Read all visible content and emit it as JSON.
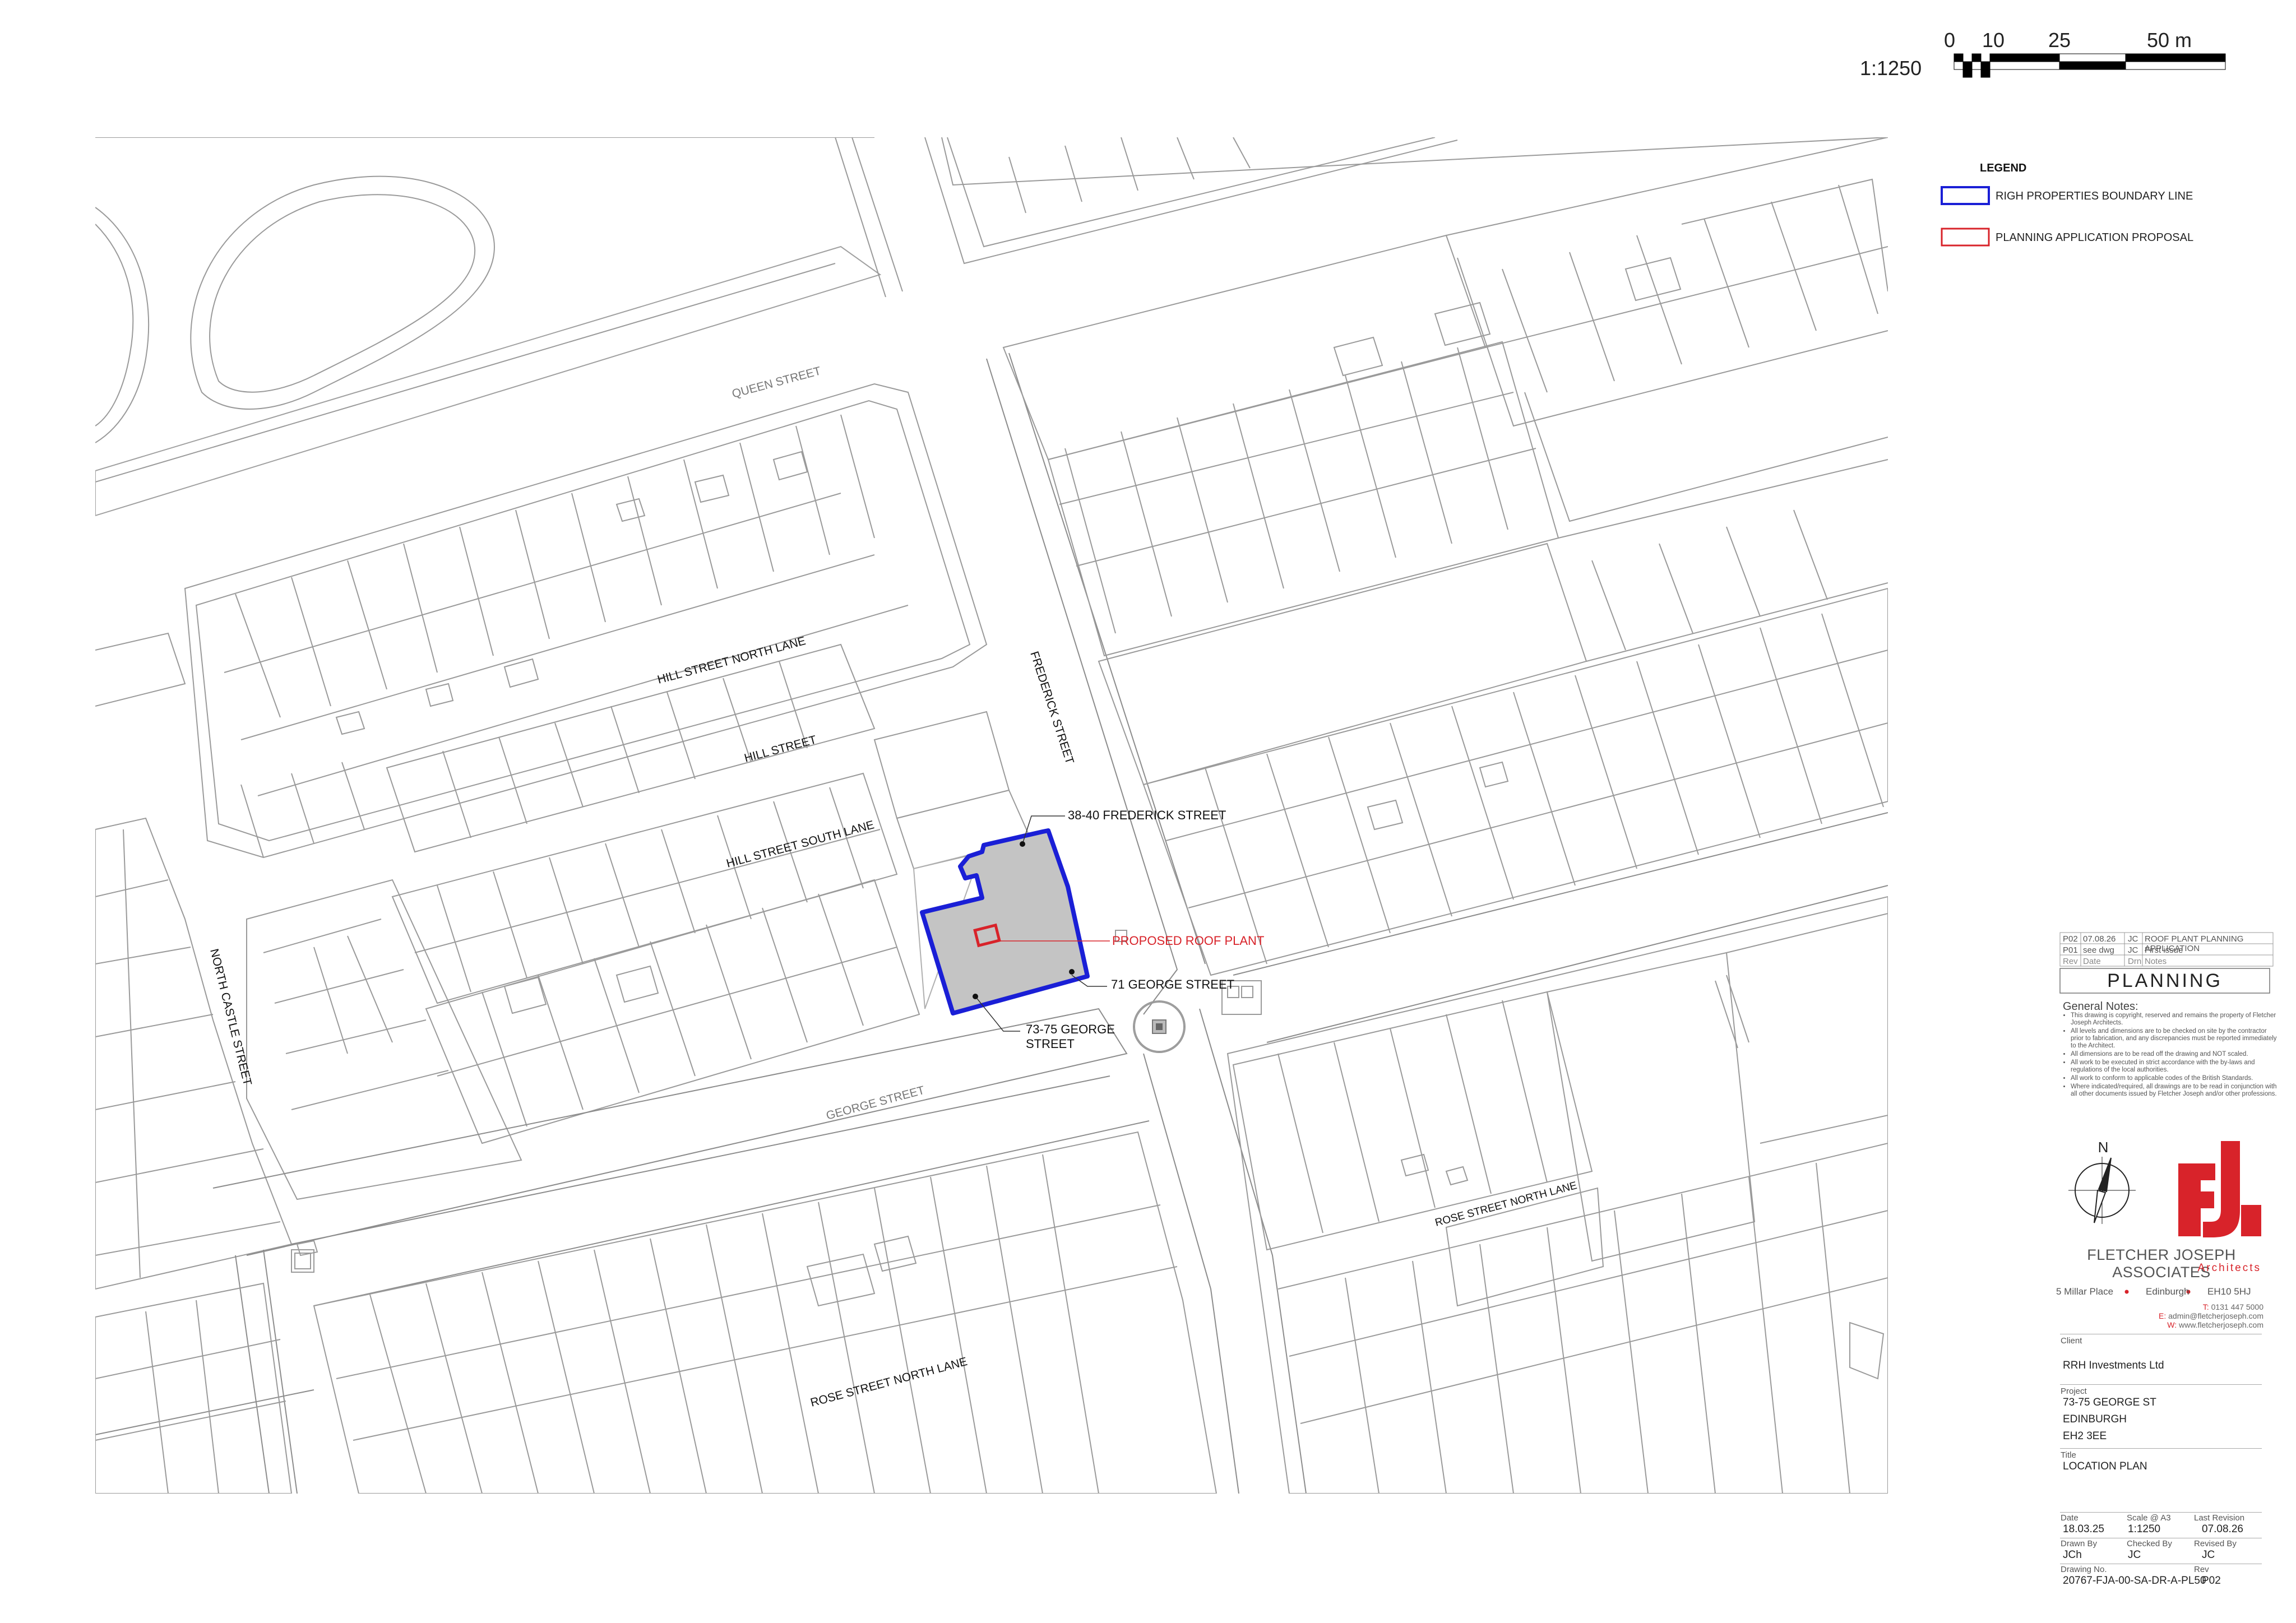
{
  "scale_bar": {
    "ratio": "1:1250",
    "ticks": [
      "0",
      "10",
      "25",
      "50 m"
    ]
  },
  "legend": {
    "title": "LEGEND",
    "items": [
      {
        "label": "RIGH PROPERTIES BOUNDARY LINE",
        "color": "#1a1fd6"
      },
      {
        "label": "PLANNING APPLICATION PROPOSAL",
        "color": "#d8232a"
      }
    ]
  },
  "streets": {
    "queen": "QUEEN STREET",
    "hill_north_lane": "HILL STREET NORTH LANE",
    "hill": "HILL STREET",
    "hill_south_lane": "HILL STREET SOUTH LANE",
    "frederick": "FREDERICK STREET",
    "north_castle": "NORTH CASTLE STREET",
    "george": "GEORGE STREET",
    "rose_north_lane_1": "ROSE STREET NORTH LANE",
    "rose_north_lane_2": "ROSE STREET NORTH LANE"
  },
  "callouts": {
    "frederick_38_40": "38-40 FREDERICK STREET",
    "proposed_roof_plant": "PROPOSED ROOF PLANT",
    "george_71": "71 GEORGE STREET",
    "george_73_75_line1": "73-75 GEORGE",
    "george_73_75_line2": "STREET"
  },
  "revisions": [
    {
      "rev": "P02",
      "date": "07.08.26",
      "by": "JC",
      "notes": "ROOF PLANT PLANNING APPLICATION"
    },
    {
      "rev": "P01",
      "date": "see dwg",
      "by": "JC",
      "notes": "First issue"
    }
  ],
  "revision_headers": {
    "rev": "Rev",
    "date": "Date",
    "by": "Drn",
    "notes": "Notes"
  },
  "status": "PLANNING",
  "general_notes": {
    "title": "General Notes:",
    "items": [
      "This drawing is copyright, reserved and remains the property of Fletcher Joseph Architects.",
      "All levels and dimensions are to be checked on site by the contractor prior to fabrication, and any discrepancies must be reported immediately to the Architect.",
      "All dimensions are to be read off the drawing and NOT scaled.",
      "All work to be executed in strict accordance with the by-laws and regulations of the local authorities.",
      "All work to conform to applicable codes of the British Standards.",
      "Where indicated/required, all drawings are to be read in conjunction with all other documents issued by Fletcher Joseph and/or other professions."
    ]
  },
  "north_label": "N",
  "firm": {
    "name": "FLETCHER JOSEPH ASSOCIATES",
    "sub": "Architects",
    "addr1": "5 Millar Place",
    "addr2": "Edinburgh",
    "addr3": "EH10 5HJ",
    "tel_prefix": "T:",
    "tel": "0131 447 5000",
    "email_prefix": "E:",
    "email": "admin@fletcherjoseph.com",
    "web_prefix": "W:",
    "web": "www.fletcherjoseph.com",
    "accent_color": "#d8232a"
  },
  "client": {
    "label": "Client",
    "value": "RRH Investments Ltd"
  },
  "project": {
    "label": "Project",
    "line1": "73-75 GEORGE ST",
    "line2": "EDINBURGH",
    "line3": "EH2 3EE"
  },
  "title": {
    "label": "Title",
    "value": "LOCATION PLAN"
  },
  "meta": {
    "date_label": "Date",
    "date": "18.03.25",
    "scale_label": "Scale @ A3",
    "scale": "1:1250",
    "last_rev_label": "Last Revision",
    "last_rev": "07.08.26",
    "drawn_label": "Drawn By",
    "drawn": "JCh",
    "checked_label": "Checked By",
    "checked": "JC",
    "revised_label": "Revised By",
    "revised": "JC",
    "drawing_no_label": "Drawing No.",
    "drawing_no": "20767-FJA-00-SA-DR-A-PL50",
    "rev_label": "Rev",
    "rev": "P02"
  }
}
